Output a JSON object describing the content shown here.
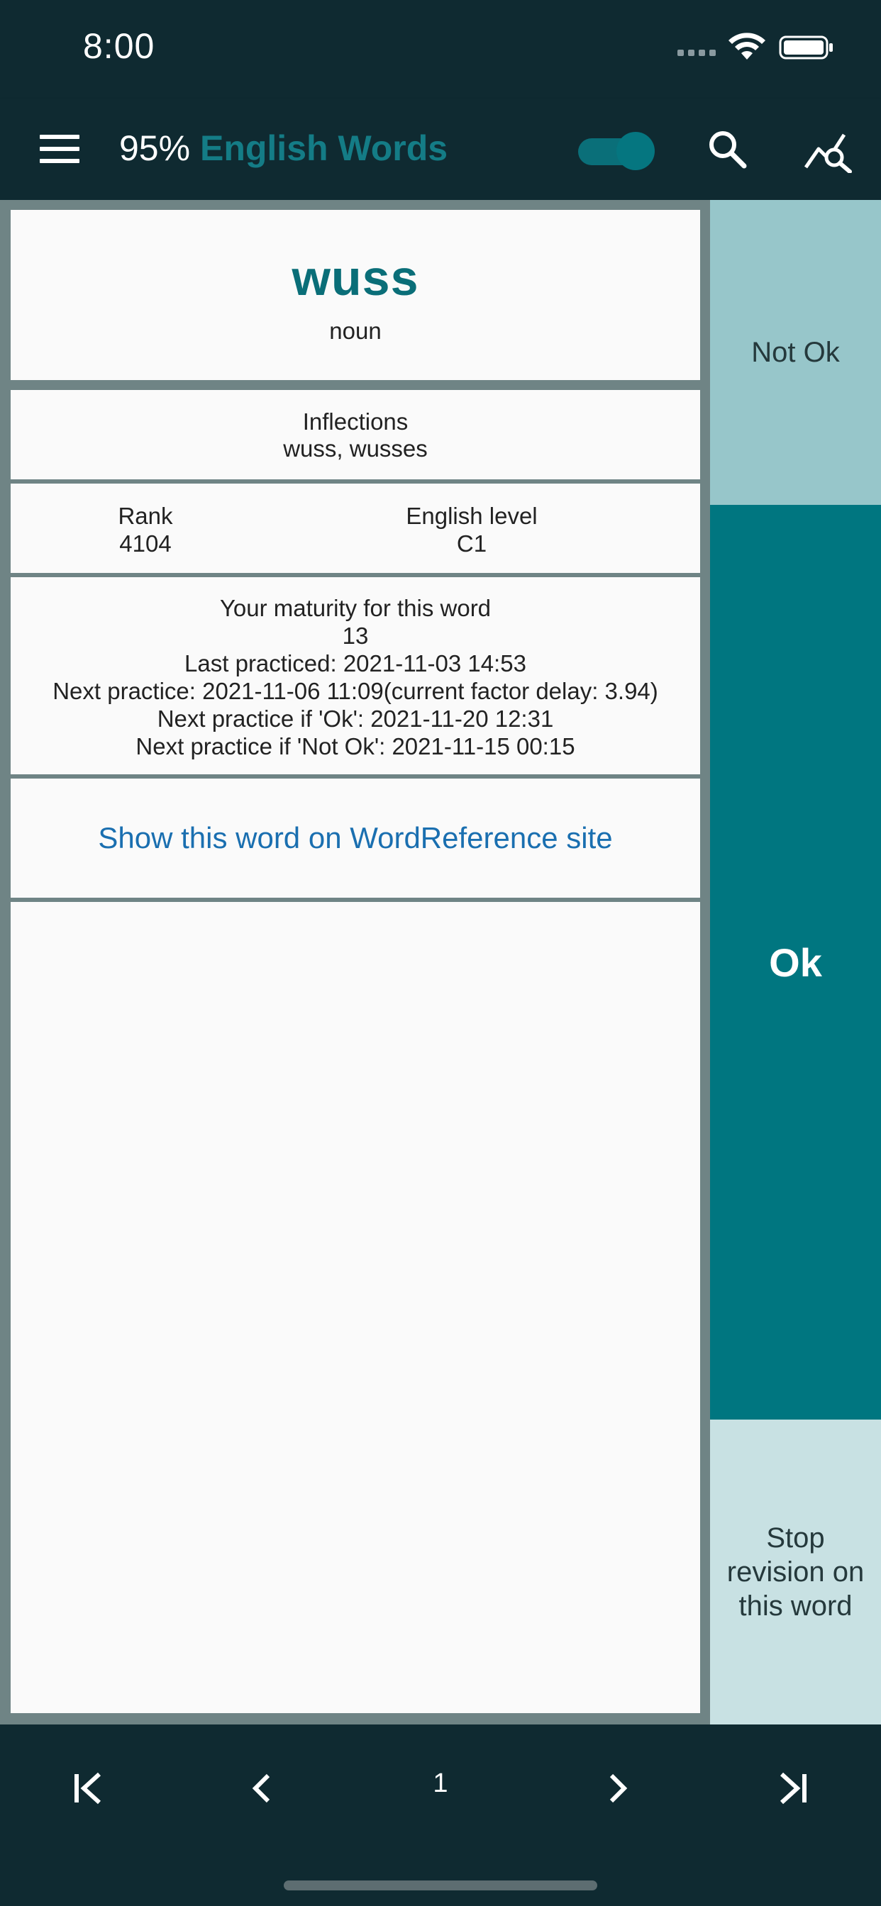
{
  "status": {
    "time": "8:00"
  },
  "appbar": {
    "percent": "95%",
    "title": "English Words"
  },
  "word": {
    "text": "wuss",
    "pos": "noun"
  },
  "inflections": {
    "label": "Inflections",
    "value": "wuss, wusses"
  },
  "rank": {
    "label": "Rank",
    "value": "4104"
  },
  "level": {
    "label": "English level",
    "value": "C1"
  },
  "maturity": {
    "label": "Your maturity for this word",
    "value": "13",
    "last": "Last practiced: 2021-11-03 14:53",
    "next": "Next practice: 2021-11-06 11:09(current factor delay: 3.94)",
    "next_ok": "Next practice if 'Ok': 2021-11-20 12:31",
    "next_notok": "Next practice if 'Not Ok': 2021-11-15 00:15"
  },
  "link": {
    "label": "Show this word on WordReference site"
  },
  "buttons": {
    "not_ok": "Not Ok",
    "ok": "Ok",
    "stop": "Stop revision on this word"
  },
  "nav": {
    "page": "1"
  },
  "icons": {
    "menu": "hamburger-menu-icon",
    "search": "search-icon",
    "stats": "stats-search-icon",
    "first": "first-page-icon",
    "prev": "chevron-left-icon",
    "next": "chevron-right-icon",
    "last": "last-page-icon"
  },
  "colors": {
    "accent": "#0a6e78",
    "ok": "#007680",
    "not_ok": "#97c6ca",
    "stop": "#c8e1e3",
    "link": "#1a6fb0",
    "bar": "#0f2a31"
  }
}
